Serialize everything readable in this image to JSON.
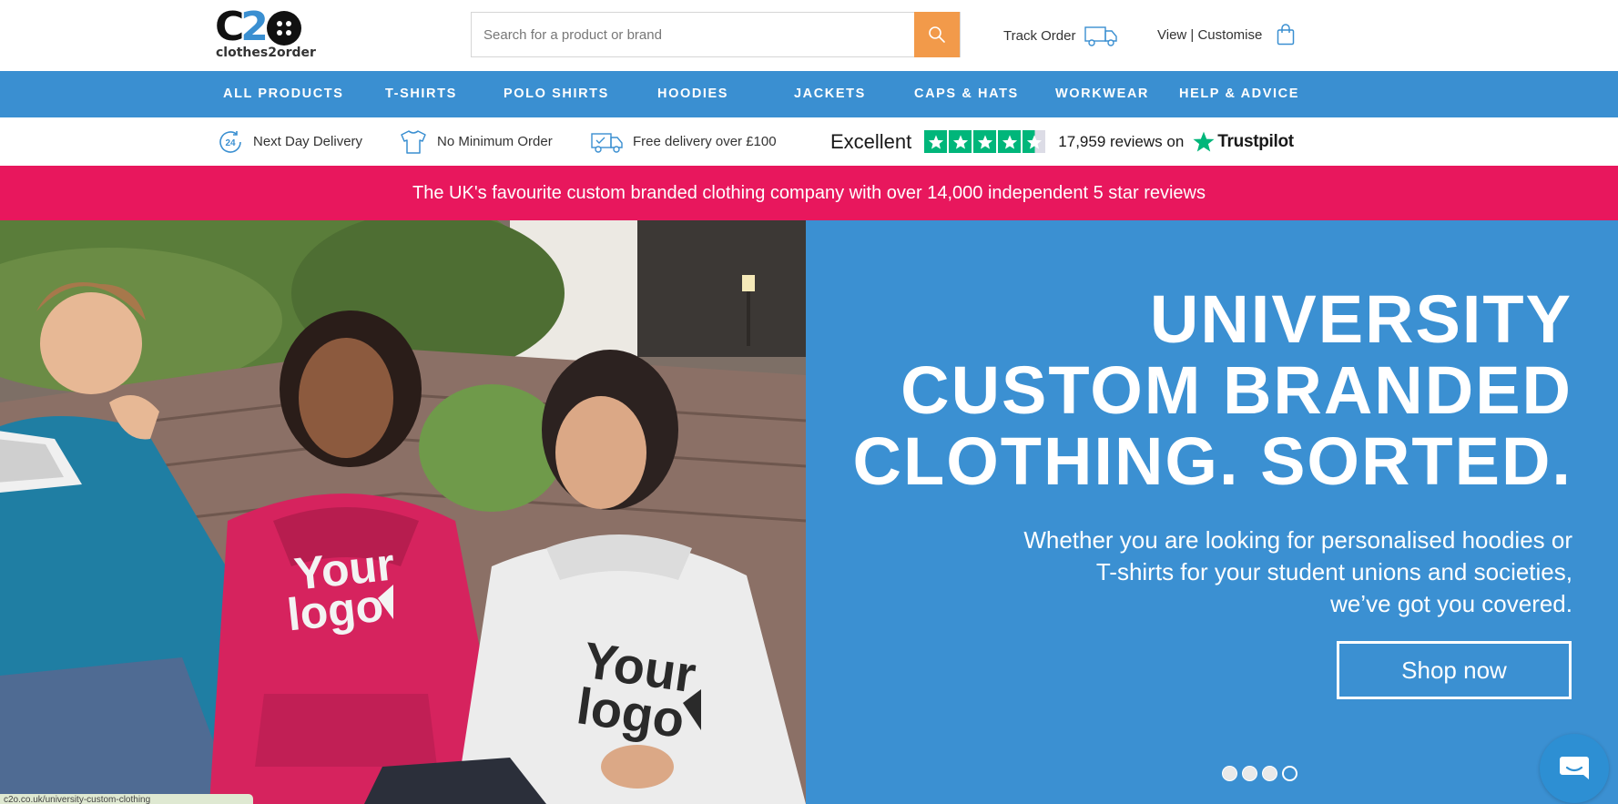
{
  "brand": {
    "logo_mark_c": "C",
    "logo_mark_2": "2",
    "logo_text": "clothes2order"
  },
  "search": {
    "placeholder": "Search for a product or brand",
    "value": "",
    "icon": "search-icon"
  },
  "header_links": {
    "track_order": "Track Order",
    "view_customise": "View | Customise"
  },
  "nav": {
    "items": [
      {
        "label": "ALL PRODUCTS"
      },
      {
        "label": "T-SHIRTS"
      },
      {
        "label": "POLO SHIRTS"
      },
      {
        "label": "HOODIES"
      },
      {
        "label": "JACKETS"
      },
      {
        "label": "CAPS & HATS"
      },
      {
        "label": "WORKWEAR"
      },
      {
        "label": "HELP & ADVICE"
      }
    ]
  },
  "usp": {
    "next_day": "Next Day Delivery",
    "next_day_badge": "24",
    "no_minimum": "No Minimum Order",
    "free_delivery": "Free delivery over £100"
  },
  "trustpilot": {
    "rating_word": "Excellent",
    "stars": 4.5,
    "count": "17,959",
    "reviews_on": "reviews on",
    "brand": "Trustpilot"
  },
  "promo": {
    "text": "The UK's favourite custom branded clothing company with over 14,000 independent 5 star reviews"
  },
  "hero": {
    "headline": [
      "UNIVERSITY",
      "CUSTOM BRANDED",
      "CLOTHING. SORTED."
    ],
    "subtext": [
      "Whether you are looking for personalised hoodies or",
      "T-shirts for your student unions and societies,",
      "we’ve got you covered."
    ],
    "cta": "Shop now",
    "slides": 4,
    "active_slide": 4,
    "photo_print_left": [
      "Your",
      "logo"
    ],
    "photo_print_right": [
      "Your",
      "logo"
    ]
  },
  "colors": {
    "nav_blue": "#3a8fd1",
    "hero_blue": "#3b90d2",
    "promo_pink": "#e8175d",
    "search_orange": "#f29a4a",
    "trustpilot_green": "#00b67a"
  },
  "status_bar": {
    "text": "c2o.co.uk/university-custom-clothing"
  }
}
